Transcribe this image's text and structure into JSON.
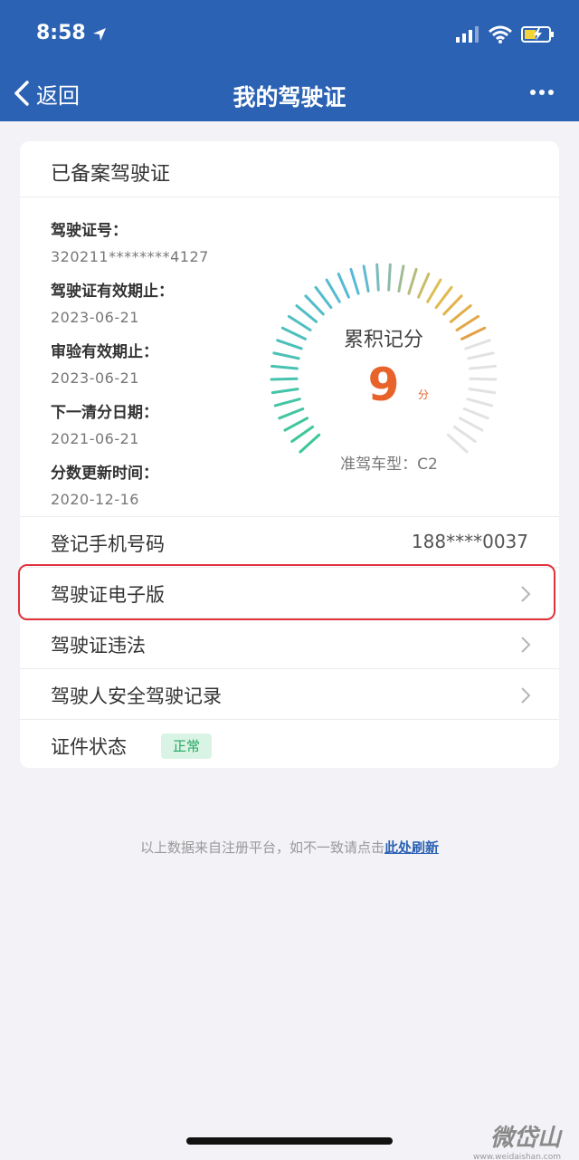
{
  "status_bar": {
    "time": "8:58"
  },
  "nav": {
    "back_label": "返回",
    "title": "我的驾驶证"
  },
  "card": {
    "header_title": "已备案驾驶证",
    "info": [
      {
        "label": "驾驶证号：",
        "value": "320211********4127"
      },
      {
        "label": "驾驶证有效期止：",
        "value": "2023-06-21"
      },
      {
        "label": "审验有效期止：",
        "value": "2023-06-21"
      },
      {
        "label": "下一清分日期：",
        "value": "2021-06-21"
      },
      {
        "label": "分数更新时间：",
        "value": "2020-12-16"
      }
    ],
    "gauge": {
      "title": "累积记分",
      "score": "9",
      "unit": "分",
      "score_value": 9,
      "max_score": 12,
      "vehicle_type": "准驾车型：C2"
    }
  },
  "rows": {
    "phone": {
      "label": "登记手机号码",
      "value": "188****0037"
    },
    "e_license": {
      "label": "驾驶证电子版"
    },
    "violations": {
      "label": "驾驶证违法"
    },
    "safety_record": {
      "label": "驾驶人安全驾驶记录"
    },
    "status": {
      "label": "证件状态",
      "badge": "正常"
    }
  },
  "footer": {
    "note": "以上数据来自注册平台，如不一致请点击",
    "link": "此处刷新"
  },
  "watermark": {
    "name": "微岱山",
    "url": "www.weidaishan.com"
  },
  "colors": {
    "brand": "#2c62b3",
    "score": "#e8632a",
    "highlight": "#e0323c",
    "badge_text": "#25a763",
    "badge_bg": "#d9f3e4"
  }
}
